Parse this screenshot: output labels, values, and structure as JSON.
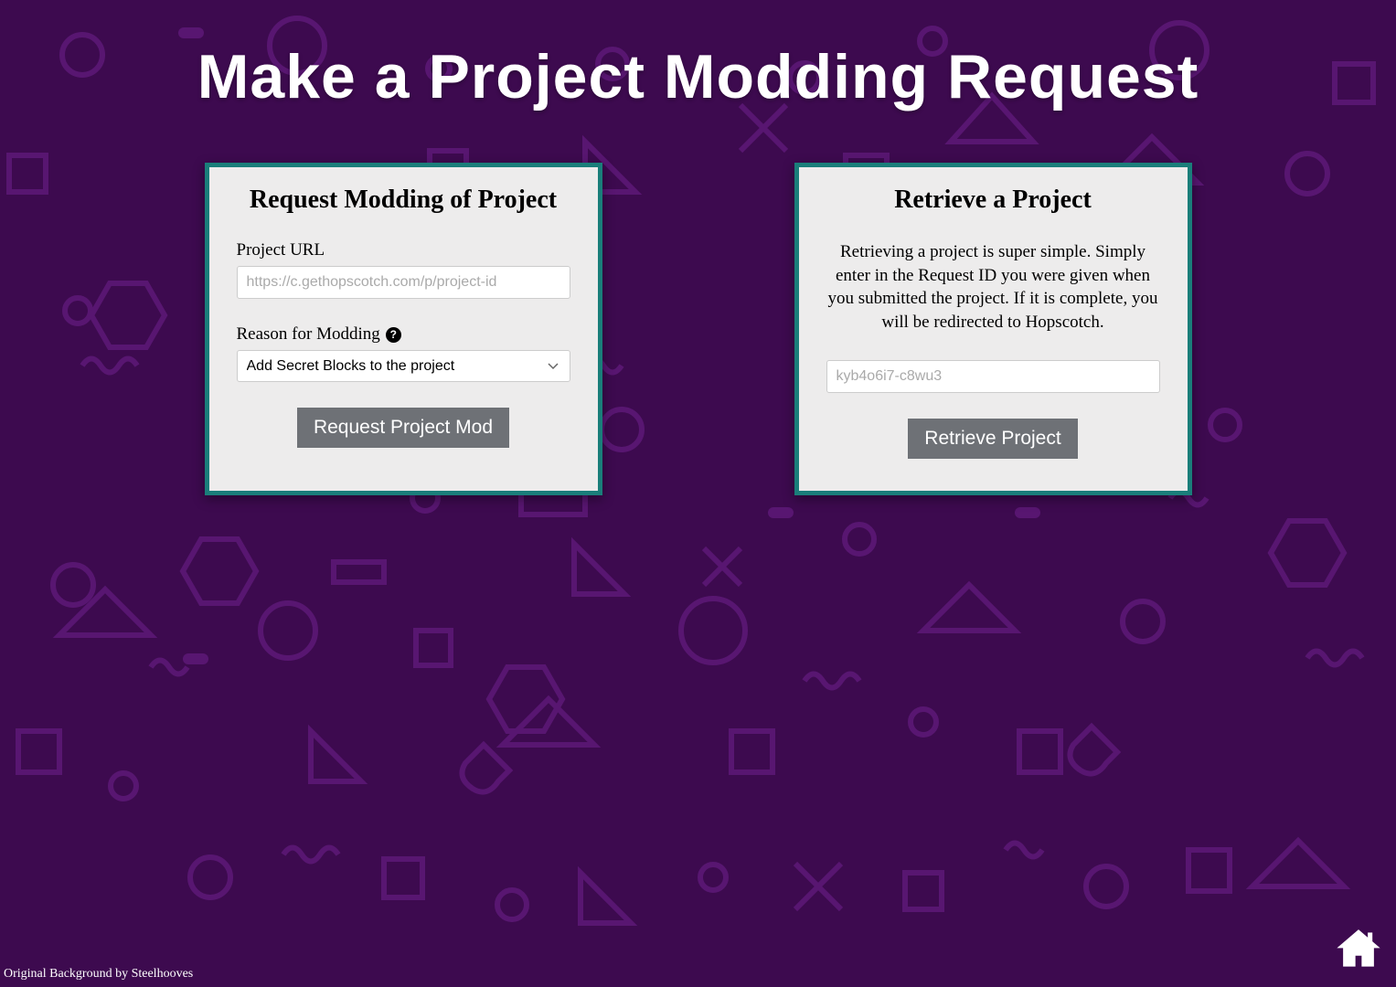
{
  "page": {
    "title": "Make a Project Modding Request"
  },
  "request_panel": {
    "title": "Request Modding of Project",
    "url_label": "Project URL",
    "url_placeholder": "https://c.gethopscotch.com/p/project-id",
    "reason_label": "Reason for Modding",
    "reason_options": [
      "Add Secret Blocks to the project"
    ],
    "reason_selected": "Add Secret Blocks to the project",
    "submit_label": "Request Project Mod"
  },
  "retrieve_panel": {
    "title": "Retrieve a Project",
    "description": "Retrieving a project is super simple. Simply enter in the Request ID you were given when you submitted the project. If it is complete, you will be redirected to Hopscotch.",
    "id_placeholder": "kyb4o6i7-c8wu3",
    "submit_label": "Retrieve Project"
  },
  "footer": {
    "credit": "Original Background by Steelhooves"
  },
  "icons": {
    "help": "?",
    "home": "home-icon"
  },
  "colors": {
    "background": "#3d0a4f",
    "shape_stroke": "#8a2db0",
    "panel_bg": "#edecec",
    "panel_border": "#1a7e7a",
    "button_bg": "#6e7176"
  }
}
